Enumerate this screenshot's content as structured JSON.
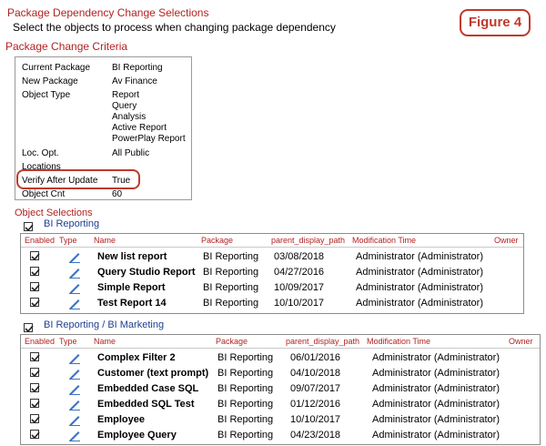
{
  "header": {
    "title": "Package Dependency Change Selections",
    "subtitle": "Select the objects to process when changing package dependency",
    "criteria_heading": "Package Change Criteria",
    "figure_label": "Figure 4"
  },
  "criteria": {
    "current_package_label": "Current Package",
    "current_package_value": "BI Reporting",
    "new_package_label": "New Package",
    "new_package_value": "Av Finance",
    "object_type_label": "Object Type",
    "object_types": [
      "Report",
      "Query",
      "Analysis",
      "Active Report",
      "PowerPlay Report"
    ],
    "loc_opt_label": "Loc. Opt.",
    "loc_opt_value": "All Public",
    "locations_label": "Locations",
    "verify_label": "Verify After Update",
    "verify_value": "True",
    "object_cnt_label": "Object Cnt",
    "object_cnt_value": "60"
  },
  "objects_heading": "Object Selections",
  "columns": {
    "enabled": "Enabled",
    "type": "Type",
    "name": "Name",
    "package": "Package",
    "path": "parent_display_path",
    "mod_time": "Modification Time",
    "owner": "Owner"
  },
  "groups": [
    {
      "label": "BI Reporting",
      "checked": true,
      "rows": [
        {
          "name": "New list report",
          "package": "BI Reporting",
          "path": "03/08/2018",
          "mod_time": "Administrator (Administrator)",
          "checked": true
        },
        {
          "name": "Query Studio Report",
          "package": "BI Reporting",
          "path": "04/27/2016",
          "mod_time": "Administrator (Administrator)",
          "checked": true
        },
        {
          "name": "Simple Report",
          "package": "BI Reporting",
          "path": "10/09/2017",
          "mod_time": "Administrator (Administrator)",
          "checked": true
        },
        {
          "name": "Test Report 14",
          "package": "BI Reporting",
          "path": "10/10/2017",
          "mod_time": "Administrator (Administrator)",
          "checked": true
        }
      ]
    },
    {
      "label": "BI Reporting / BI Marketing",
      "checked": true,
      "rows": [
        {
          "name": "Complex Filter 2",
          "package": "BI Reporting",
          "path": "06/01/2016",
          "mod_time": "Administrator (Administrator)",
          "checked": true
        },
        {
          "name": "Customer (text prompt)",
          "package": "BI Reporting",
          "path": "04/10/2018",
          "mod_time": "Administrator (Administrator)",
          "checked": true
        },
        {
          "name": "Embedded Case SQL",
          "package": "BI Reporting",
          "path": "09/07/2017",
          "mod_time": "Administrator (Administrator)",
          "checked": true
        },
        {
          "name": "Embedded SQL Test",
          "package": "BI Reporting",
          "path": "01/12/2016",
          "mod_time": "Administrator (Administrator)",
          "checked": true
        },
        {
          "name": "Employee",
          "package": "BI Reporting",
          "path": "10/10/2017",
          "mod_time": "Administrator (Administrator)",
          "checked": true
        },
        {
          "name": "Employee Query",
          "package": "BI Reporting",
          "path": "04/23/2018",
          "mod_time": "Administrator (Administrator)",
          "checked": true
        }
      ]
    }
  ],
  "icons": {
    "report_icon": "report-pencil-icon",
    "checkbox": "checkmark-icon"
  },
  "colors": {
    "accent_red": "#b22222",
    "link_blue": "#1f3f8f",
    "highlight": "#c0392b"
  }
}
